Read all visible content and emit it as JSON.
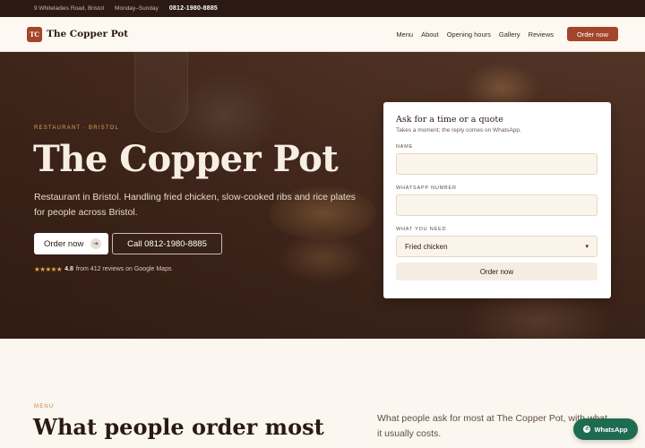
{
  "topbar": {
    "address": "9 Whiteladies Road, Bristol",
    "hours": "Monday–Sunday",
    "phone": "0812-1980-8885"
  },
  "nav": {
    "logo_initials": "TC",
    "brand": "The Copper Pot",
    "links": [
      "Menu",
      "About",
      "Opening hours",
      "Gallery",
      "Reviews"
    ],
    "cta": "Order now"
  },
  "hero": {
    "eyebrow": "RESTAURANT · BRISTOL",
    "title": "The Copper Pot",
    "description": "Restaurant in Bristol. Handling fried chicken, slow-cooked ribs and rice plates for people across Bristol.",
    "order_button": "Order now",
    "call_button": "Call 0812-1980-8885",
    "rating_stars": "★★★★★",
    "rating_score": "4.8",
    "rating_text": "from 412 reviews on Google Maps"
  },
  "form": {
    "title": "Ask for a time or a quote",
    "subtitle": "Takes a moment; the reply comes on WhatsApp.",
    "name_label": "NAME",
    "name_value": "",
    "whatsapp_label": "WHATSAPP NUMBER",
    "whatsapp_value": "",
    "need_label": "WHAT YOU NEED",
    "need_selected": "Fried chicken",
    "submit": "Order now"
  },
  "menu_section": {
    "eyebrow": "MENU",
    "title": "What people order most",
    "description": "What people ask for most at The Copper Pot, with what it usually costs."
  },
  "whatsapp_button": "WhatsApp",
  "colors": {
    "accent": "#a2452a",
    "dark": "#2b1a13",
    "gold": "#d9a35e",
    "whatsapp": "#1f6b52"
  }
}
